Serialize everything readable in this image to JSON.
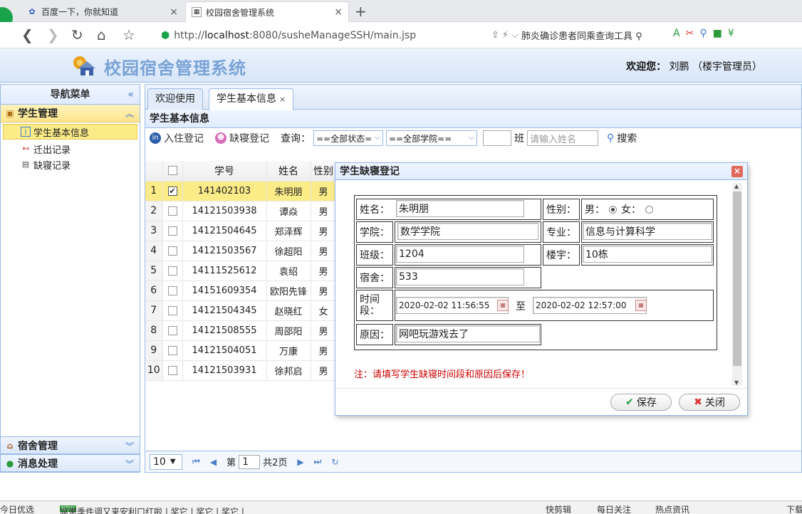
{
  "browser": {
    "tabs": [
      {
        "title": "百度一下，你就知道",
        "close": "×"
      },
      {
        "title": "校园宿舍管理系统",
        "close": "×"
      }
    ],
    "new_tab": "+",
    "url_prefix": "http://",
    "url_host": "localhost",
    "url_rest": ":8080/susheManageSSH/main.jsp",
    "search_text": "肺炎确诊患者同乘查询工具"
  },
  "app": {
    "title": "校园宿舍管理系统",
    "welcome_label": "欢迎您：",
    "welcome_user": "刘鹏 （楼宇管理员）"
  },
  "nav": {
    "header": "导航菜单",
    "collapse": "«",
    "group_student": "学生管理",
    "items": [
      "学生基本信息",
      "迁出记录",
      "缺寝记录"
    ],
    "group_dorm": "宿舍管理",
    "group_msg": "消息处理"
  },
  "content": {
    "tabs": [
      "欢迎使用",
      "学生基本信息"
    ],
    "panel_title": "学生基本信息",
    "toolbar": {
      "checkin": "入住登记",
      "absence": "缺寝登记",
      "query_label": "查询：",
      "status_select": "==全部状态=",
      "college_select": "==全部学院==",
      "class_label": "班",
      "name_placeholder": "请输入姓名",
      "search": "搜索"
    },
    "grid": {
      "headers": [
        "学号",
        "姓名",
        "性别"
      ],
      "rows": [
        {
          "n": "1",
          "id": "141402103",
          "name": "朱明朋",
          "sex": "男",
          "checked": true
        },
        {
          "n": "2",
          "id": "14121503938",
          "name": "谭焱",
          "sex": "男",
          "checked": false
        },
        {
          "n": "3",
          "id": "14121504645",
          "name": "郑泽辉",
          "sex": "男",
          "checked": false
        },
        {
          "n": "4",
          "id": "14121503567",
          "name": "徐超阳",
          "sex": "男",
          "checked": false
        },
        {
          "n": "5",
          "id": "14111525612",
          "name": "袁绍",
          "sex": "男",
          "checked": false
        },
        {
          "n": "6",
          "id": "14151609354",
          "name": "欧阳先锋",
          "sex": "男",
          "checked": false
        },
        {
          "n": "7",
          "id": "14121504345",
          "name": "赵晓红",
          "sex": "女",
          "checked": false
        },
        {
          "n": "8",
          "id": "14121508555",
          "name": "周邵阳",
          "sex": "男",
          "checked": false
        },
        {
          "n": "9",
          "id": "14121504051",
          "name": "万康",
          "sex": "男",
          "checked": false
        },
        {
          "n": "10",
          "id": "14121503931",
          "name": "徐邦启",
          "sex": "男",
          "checked": false
        }
      ]
    },
    "pager": {
      "page_size": "10",
      "page_label": "第",
      "page_value": "1",
      "total": "共2页"
    }
  },
  "dialog": {
    "title": "学生缺寝登记",
    "close": "×",
    "labels": {
      "name": "姓名：",
      "sex": "性别：",
      "college": "学院：",
      "major": "专业：",
      "class": "班级：",
      "building": "楼宇：",
      "room": "宿舍：",
      "period": "时间段：",
      "reason": "原因：",
      "male": "男：",
      "female": "女：",
      "to": "至"
    },
    "values": {
      "name": "朱明朋",
      "college": "数学学院",
      "major": "信息与计算科学",
      "class": "1204",
      "building": "10栋",
      "room": "533",
      "start": "2020-02-02 11:56:55",
      "end": "2020-02-02 12:57:00",
      "reason": "网吧玩游戏去了"
    },
    "note": "注：请填写学生缺寝时间段和原因后保存！",
    "save": "保存",
    "cancel": "关闭"
  },
  "statusbar": {
    "left": "今日优选",
    "news": "腐患季件调又来安利口红啦 | 奖它 | 奖它 | 奖它 |",
    "new_badge": "NEW",
    "r1": "快剪辑",
    "r2": "每日关注",
    "r3": "热点资讯",
    "r4": "下载"
  },
  "colors": {
    "accent_blue": "#99bbe8",
    "selected_yellow": "#fbec88",
    "title_blue": "#7aa3d6",
    "note_red": "#cc0000"
  }
}
